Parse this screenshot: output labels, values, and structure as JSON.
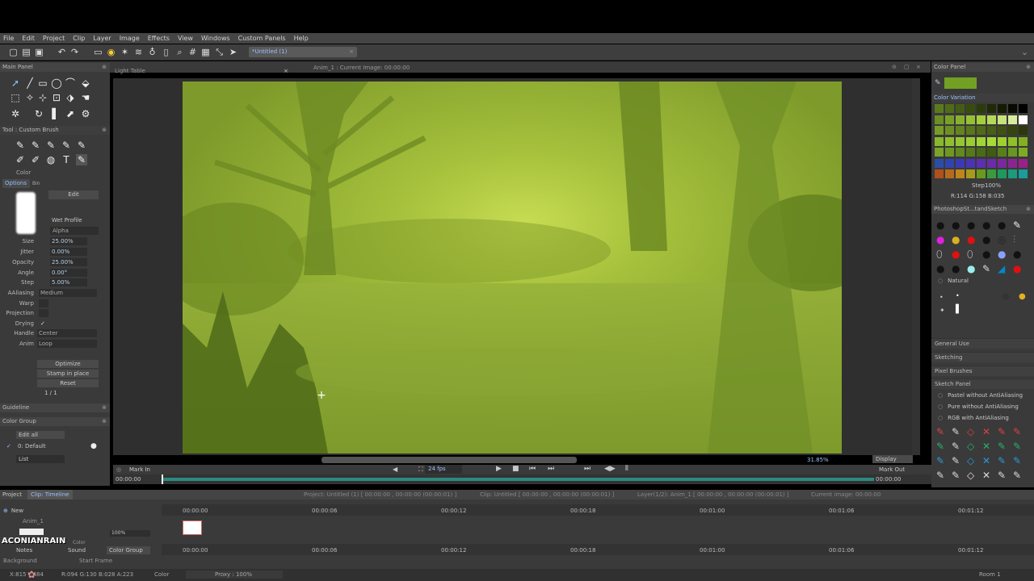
{
  "menu": [
    "File",
    "Edit",
    "Project",
    "Clip",
    "Layer",
    "Image",
    "Effects",
    "View",
    "Windows",
    "Custom Panels",
    "Help"
  ],
  "toolbar": {
    "doc_tab": "*Untitled (1)"
  },
  "subbar": {
    "light_table": "Light Table",
    "anim_info": "Anim_1 : Current Image: 00:00:00"
  },
  "main_panel": {
    "title": "Main Panel"
  },
  "tool_panel": {
    "title": "Tool : Custom Brush",
    "color_label": "Color",
    "tab_options": "Options",
    "tab_bin": "Bin",
    "edit": "Edit",
    "wet_profile": "Wet Profile",
    "alpha": "Alpha"
  },
  "brush_params": [
    {
      "label": "Size",
      "value": "25.00%"
    },
    {
      "label": "Jitter",
      "value": "0.00%"
    },
    {
      "label": "Opacity",
      "value": "25.00%"
    },
    {
      "label": "Angle",
      "value": "0.00°"
    },
    {
      "label": "Step",
      "value": "5.00%"
    },
    {
      "label": "AAliasing",
      "value": "Medium"
    },
    {
      "label": "Warp",
      "value": ""
    },
    {
      "label": "Projection",
      "value": ""
    },
    {
      "label": "Drying",
      "value": "✓"
    },
    {
      "label": "Handle",
      "value": "Center"
    },
    {
      "label": "Anim",
      "value": "Loop"
    }
  ],
  "tool_buttons": {
    "optimize": "Optimize",
    "stamp": "Stamp in place",
    "reset": "Reset",
    "pager": "1 / 1"
  },
  "guideline": {
    "title": "Guideline"
  },
  "color_group": {
    "title": "Color Group",
    "edit_all": "Edit all",
    "default": "0: Default",
    "list": "List"
  },
  "color_panel": {
    "title": "Color Panel",
    "variation": "Color Variation",
    "step_label": "Step",
    "step_value": "100%",
    "rgb": "R:114 G:158 B:035"
  },
  "photoshop_panel": {
    "title": "PhotoshopSt...tandSketch",
    "natural": "Natural"
  },
  "right_sections": [
    "General Use",
    "Sketching",
    "Pixel Brushes",
    "Sketch Panel"
  ],
  "sketch_items": [
    "Pastel without AntiAliasing",
    "Pure without AntiAliasing",
    "RGB with AntiAliasing"
  ],
  "canvas_status": {
    "zoom": "31.85%",
    "display": "Display"
  },
  "playbar": {
    "mark_in": "Mark In",
    "fps": "24 fps",
    "mark_out": "Mark Out",
    "time_left": "00:00:00",
    "time_right": "00:00:00"
  },
  "timeline": {
    "tab_project": "Project",
    "tab_clip": "Clip: Timeline",
    "info_project": "Project: Untitled (1) [ 00:00:00 , 00:00:00 (00:00:01) ]",
    "info_clip": "Clip: Untitled [ 00:00:00 , 00:00:00 (00:00:01) ]",
    "info_layer": "Layer(1/2): Anim_1 [ 00:00:00 , 00:00:00 (00:00:01) ]",
    "info_current": "Current image: 00:00:00",
    "new": "New",
    "anim": "Anim_1",
    "ticks": [
      "00:00:00",
      "00:00:06",
      "00:00:12",
      "00:00:18",
      "00:01:00",
      "00:01:06",
      "00:01:12"
    ],
    "notes": "Notes",
    "sound": "Sound",
    "color_group": "Color Group",
    "background": "Background",
    "start_frame": "Start Frame",
    "opacity": "100%",
    "color": "Color"
  },
  "watermark": "ACONIANRAIN",
  "status": {
    "coords": "X:815 Y:484",
    "rgb": "R:094 G:130 B:028 A:223",
    "color": "Color",
    "proxy": "Proxy : 100%",
    "room": "Room 1"
  }
}
